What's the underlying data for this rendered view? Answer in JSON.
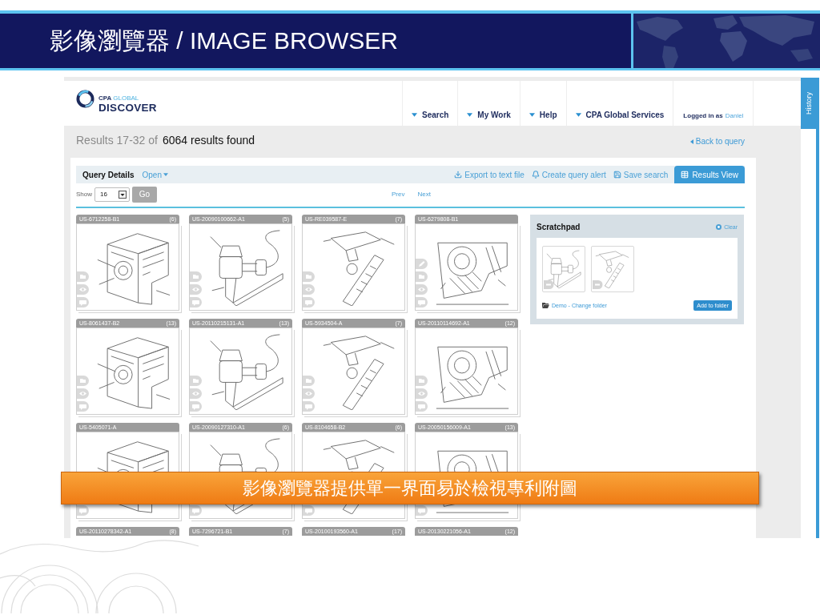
{
  "slide_title": "影像瀏覽器 / IMAGE BROWSER",
  "app": {
    "logo": {
      "brand": "CPA",
      "brand_accent": "GLOBAL",
      "product": "DISCOVER"
    },
    "nav": [
      {
        "label": "Search"
      },
      {
        "label": "My Work"
      },
      {
        "label": "Help"
      },
      {
        "label": "CPA Global Services"
      }
    ],
    "login": {
      "prefix": "Logged in as",
      "user": "Daniel"
    },
    "results_summary": {
      "range": "Results 17-32 of",
      "total": "6064 results found"
    },
    "back_link": "Back to query",
    "query_bar": {
      "title": "Query Details",
      "toggle": "Open",
      "actions": [
        {
          "kind": "export",
          "label": "Export to text file"
        },
        {
          "kind": "alert",
          "label": "Create query alert"
        },
        {
          "kind": "save",
          "label": "Save search"
        }
      ],
      "view_tab": {
        "label": "Results View",
        "selected": true
      }
    },
    "paging": {
      "show_label": "Show",
      "page_size": "16",
      "go": {
        "label": "Go",
        "disabled": true
      },
      "prev": "Prev",
      "next": "Next"
    },
    "results": [
      {
        "number": "US-6712258-B1",
        "count": "(6)",
        "actions": [
          {
            "kind": "folder"
          },
          {
            "kind": "eye"
          },
          {
            "kind": "comment"
          }
        ],
        "thumbnail_visible": true
      },
      {
        "number": "US-20090100662-A1",
        "count": "(5)",
        "actions": [
          {
            "kind": "folder"
          },
          {
            "kind": "eye"
          },
          {
            "kind": "comment"
          }
        ],
        "thumbnail_visible": true
      },
      {
        "number": "US-RE039587-E",
        "count": "(7)",
        "actions": [
          {
            "kind": "folder"
          },
          {
            "kind": "eye"
          },
          {
            "kind": "comment"
          }
        ],
        "thumbnail_visible": true
      },
      {
        "number": "US-6279808-B1",
        "actions": [
          {
            "kind": "pencil"
          },
          {
            "kind": "folder"
          },
          {
            "kind": "eye"
          },
          {
            "kind": "comment"
          }
        ],
        "thumbnail_visible": true
      },
      {
        "number": "US-8061437-B2",
        "count": "(13)",
        "actions": [
          {
            "kind": "folder"
          },
          {
            "kind": "eye"
          },
          {
            "kind": "comment"
          }
        ],
        "thumbnail_visible": true
      },
      {
        "number": "US-20110215131-A1",
        "count": "(13)",
        "actions": [
          {
            "kind": "folder"
          },
          {
            "kind": "eye"
          },
          {
            "kind": "comment"
          }
        ],
        "thumbnail_visible": true
      },
      {
        "number": "US-5934504-A",
        "count": "(7)",
        "actions": [
          {
            "kind": "folder"
          },
          {
            "kind": "eye"
          },
          {
            "kind": "comment"
          }
        ],
        "thumbnail_visible": true
      },
      {
        "number": "US-20110114692-A1",
        "count": "(12)",
        "actions": [
          {
            "kind": "folder"
          },
          {
            "kind": "eye"
          },
          {
            "kind": "comment"
          }
        ],
        "thumbnail_visible": true
      },
      {
        "number": "US-5405071-A",
        "actions": [
          {
            "kind": "comment"
          }
        ],
        "thumbnail_visible": true
      },
      {
        "number": "US-20090127310-A1",
        "count": "(6)",
        "actions": [
          {
            "kind": "comment"
          }
        ],
        "thumbnail_visible": true
      },
      {
        "number": "US-8104658-B2",
        "count": "(6)",
        "actions": [
          {
            "kind": "comment"
          }
        ],
        "thumbnail_visible": true
      },
      {
        "number": "US-20050156009-A1",
        "count": "(13)",
        "actions": [
          {
            "kind": "comment"
          }
        ],
        "thumbnail_visible": true
      },
      {
        "number": "US-20110278342-A1",
        "count": "(8)",
        "thumbnail_visible": false
      },
      {
        "number": "US-7296721-B1",
        "count": "(7)",
        "thumbnail_visible": false
      },
      {
        "number": "US-20100193560-A1",
        "count": "(17)",
        "thumbnail_visible": false
      },
      {
        "number": "US-20130221056-A1",
        "count": "(12)",
        "thumbnail_visible": false
      }
    ],
    "scratchpad": {
      "title": "Scratchpad",
      "clear": "Clear",
      "items": [
        {
          "kind": "minus"
        },
        {
          "kind": "minus"
        }
      ],
      "folder_link": "Demo - Change folder",
      "add_button": "Add to folder"
    },
    "history_tab": "History"
  },
  "banner": "影像瀏覽器提供單一界面易於檢視專利附圖"
}
